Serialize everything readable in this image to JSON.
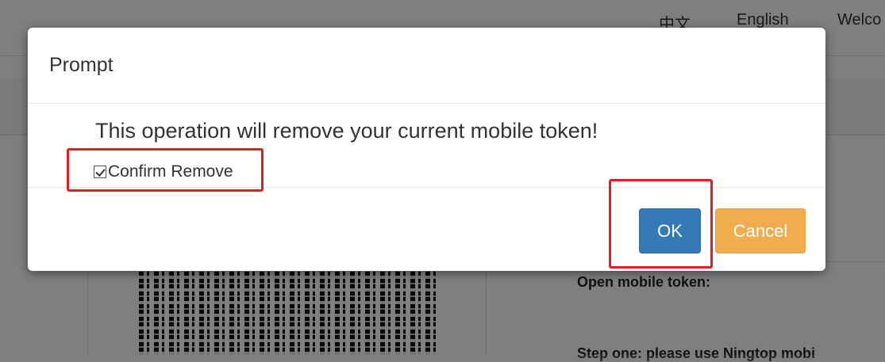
{
  "background": {
    "lang_zh": "中文",
    "lang_en": "English",
    "welcome": "Welco",
    "open_token_label": "Open mobile token:",
    "step_one": "Step one: please use Ningtop mobi"
  },
  "modal": {
    "title": "Prompt",
    "message": "This operation will remove your current mobile token!",
    "confirm_label": "Confirm Remove",
    "confirm_checked": true,
    "ok_label": "OK",
    "cancel_label": "Cancel"
  },
  "colors": {
    "primary": "#337ab7",
    "warning": "#f0ad4e",
    "annotation": "#e02020"
  }
}
